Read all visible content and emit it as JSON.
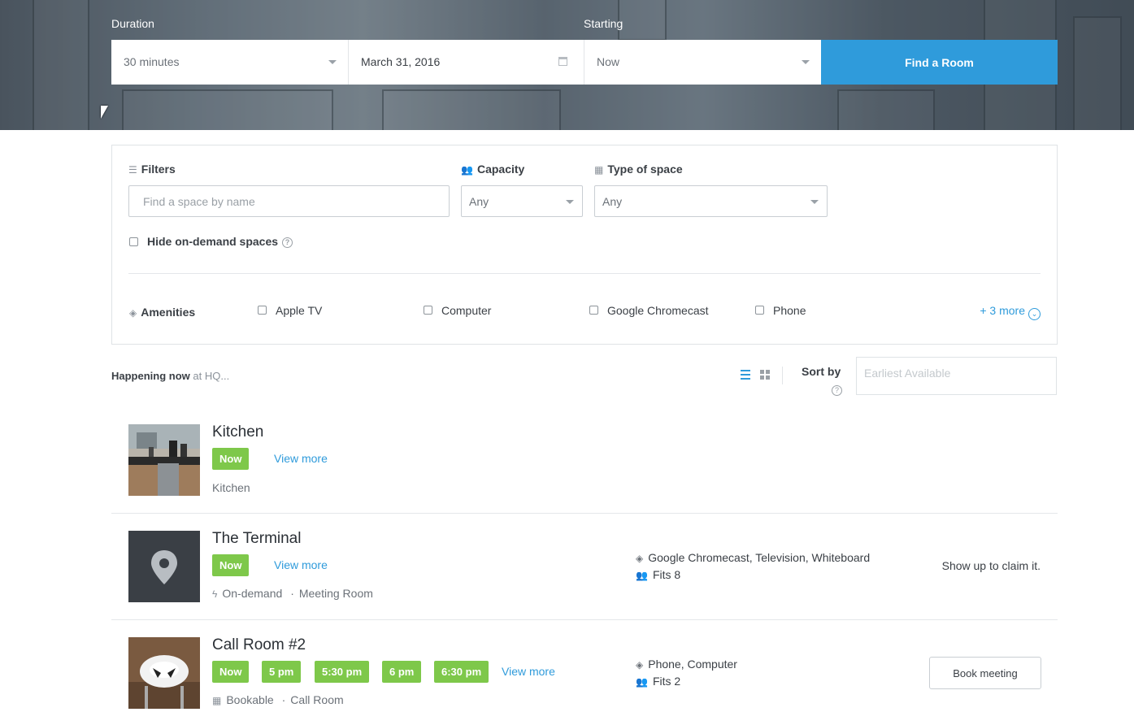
{
  "search": {
    "duration_label": "Duration",
    "starting_label": "Starting",
    "duration_value": "30 minutes",
    "date_value": "March 31, 2016",
    "start_value": "Now",
    "find_button": "Find a Room"
  },
  "filters": {
    "filters_label": "Filters",
    "name_placeholder": "Find a space by name",
    "capacity_label": "Capacity",
    "capacity_value": "Any",
    "type_label": "Type of space",
    "type_value": "Any",
    "hide_on_demand_label": "Hide on-demand spaces",
    "help_glyph": "?",
    "amenities_label": "Amenities",
    "amenities": [
      "Apple TV",
      "Computer",
      "Google Chromecast",
      "Phone"
    ],
    "more_link": "+ 3 more"
  },
  "results_header": {
    "happening_bold": "Happening now",
    "happening_rest": "at HQ...",
    "sort_label": "Sort by",
    "sort_placeholder": "Earliest Available"
  },
  "rooms": [
    {
      "title": "Kitchen",
      "tags": [
        "Now"
      ],
      "view_more": "View more",
      "meta": "Kitchen"
    },
    {
      "title": "The Terminal",
      "tags": [
        "Now"
      ],
      "view_more": "View more",
      "meta_kind": "On-demand",
      "meta_sep": "·",
      "meta_type": "Meeting Room",
      "amenities": "Google Chromecast, Television, Whiteboard",
      "fits": "Fits 8",
      "action": "Show up to claim it."
    },
    {
      "title": "Call Room #2",
      "tags": [
        "Now",
        "5 pm",
        "5:30 pm",
        "6 pm",
        "6:30 pm"
      ],
      "view_more": "View more",
      "meta_kind": "Bookable",
      "meta_sep": "·",
      "meta_type": "Call Room",
      "amenities": "Phone, Computer",
      "fits": "Fits 2",
      "action": "Book meeting"
    }
  ],
  "colors": {
    "accent": "#2f9bdb",
    "tag_green": "#7ec84a"
  }
}
